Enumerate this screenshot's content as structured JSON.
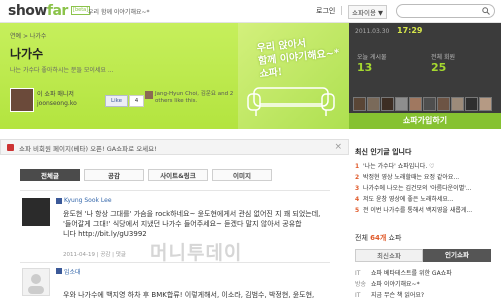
{
  "header": {
    "logo_main": "show",
    "logo_accent": "far",
    "beta": "[beta]",
    "tagline": "우리 함께 이야기해요~*",
    "login": "로그인",
    "guide": "쇼파이용 ▼"
  },
  "hero": {
    "breadcrumb": "연예 > 나가수",
    "title": "나가수",
    "subtitle": "나는 가수다 좋아하시는 분들 모이세요 ...",
    "owner_label": "이 쇼파 매니저",
    "owner_id": "joonseong.ko",
    "like_label": "Like",
    "like_count": "4",
    "fb_text": "Jang-Hyun Choi, 김운요 and 2 others like this.",
    "art_text_line1": "우리 앉아서",
    "art_text_line2": "함께 이야기해요~*",
    "art_text_line3": "쇼파!"
  },
  "stats": {
    "date": "2011.03.30",
    "time": "17:29",
    "today_label": "오늘 게시물",
    "today_value": "13",
    "total_label": "전체 회원",
    "total_value": "25"
  },
  "join_button": "쇼파가입하기",
  "notice": {
    "text": "쇼파 비회원 페이지(베타) 오픈! GA쇼파로 오세요!",
    "close": "×"
  },
  "tabs": [
    {
      "label": "전체글"
    },
    {
      "label": "공감"
    },
    {
      "label": "사이트&링크"
    },
    {
      "label": "이미지"
    }
  ],
  "posts": [
    {
      "user": "Kyung Sook Lee",
      "body_line1": "윤도현 '나 항상 그대를' 가슴을 rock하네요~ 윤도현에게서 관심 없어진 지 꽤 되었는데,",
      "body_line2": "'들어갈게 그대!' 식당에서 지냈던 나가수 들어주세요~ 듣겠다 말지 않아서 공유합",
      "body_line3": "니다 http://bit.ly/gU3992",
      "meta": "2011-04-19 | 공감 | 댓글"
    },
    {
      "user": "임소대",
      "body_line1": "우와 나가수에 백지영 하차 후 BMK합류! 이렇게해서, 이소라, 김범수, 박정현, 윤도현,",
      "meta": ""
    }
  ],
  "watermark": "머니투데이",
  "sidebar": {
    "hot_title": "최신 인기글 입니다",
    "hot": [
      {
        "n": "1",
        "text": "'나는 가수다' 쇼파입니다. ♡"
      },
      {
        "n": "2",
        "text": "박정현 영상 노래할때는 요정 같아요..."
      },
      {
        "n": "3",
        "text": "나가수에 나오는 김건모의 '아름다운이별'..."
      },
      {
        "n": "4",
        "text": "저도 윤창 영상에 좋은 노래하세요..."
      },
      {
        "n": "5",
        "text": "전 이번 나가수를 통해서 백지영을 새롭게..."
      }
    ],
    "members_label": "전체",
    "members_count": "64개",
    "members_suffix": "쇼파",
    "tab_left": "최신쇼파",
    "tab_right": "인기쇼파",
    "recent": [
      {
        "k": "IT",
        "text": "쇼파 베타테스트를 위한 GA쇼파"
      },
      {
        "k": "방송",
        "text": "쇼파 이야기해요~*"
      },
      {
        "k": "IT",
        "text": "지금 무슨 책 읽어요?"
      }
    ]
  },
  "colors": {
    "accent_green": "#8bc34a",
    "hero_green": "#b3e43f",
    "dark_panel": "#3b3b3b",
    "hot_number": "#e05a2a"
  }
}
